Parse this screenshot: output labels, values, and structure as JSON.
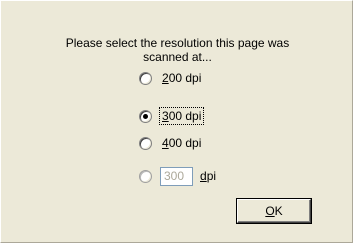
{
  "dialog": {
    "prompt_line1": "Please select the resolution this page was",
    "prompt_line2": "scanned at...",
    "options": [
      {
        "label_accel": "2",
        "label_rest": "00 dpi",
        "selected": false
      },
      {
        "label_accel": "3",
        "label_rest": "00 dpi",
        "selected": true
      },
      {
        "label_accel": "4",
        "label_rest": "00 dpi",
        "selected": false
      }
    ],
    "custom": {
      "value": "300",
      "unit_accel": "d",
      "unit_rest": "pi",
      "selected": false
    },
    "ok_button": {
      "accel": "O",
      "rest": "K"
    }
  },
  "colors": {
    "dialog_background": "#ece9d8",
    "disabled_text": "#aca899"
  }
}
